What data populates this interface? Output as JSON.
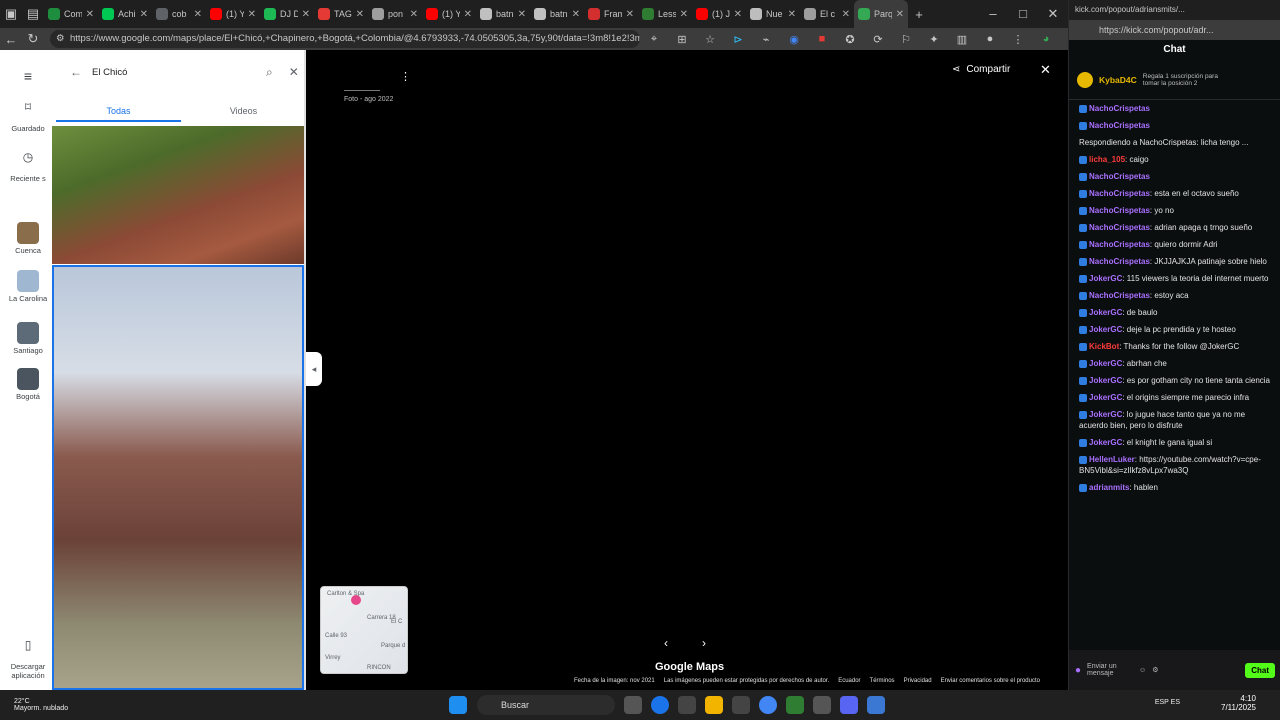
{
  "browser": {
    "tabs": [
      {
        "label": "Com",
        "color": "#1e8e3e"
      },
      {
        "label": "Achi",
        "color": "#00c853"
      },
      {
        "label": "cob",
        "color": "#5f6368"
      },
      {
        "label": "(1) Y",
        "color": "#ff0000"
      },
      {
        "label": "DJ D",
        "color": "#1db954"
      },
      {
        "label": "TAG",
        "color": "#e53935"
      },
      {
        "label": "pon",
        "color": "#9e9e9e"
      },
      {
        "label": "(1) Y",
        "color": "#ff0000"
      },
      {
        "label": "batn",
        "color": "#c0c0c0"
      },
      {
        "label": "batn",
        "color": "#c0c0c0"
      },
      {
        "label": "Fram",
        "color": "#d32f2f"
      },
      {
        "label": "Less",
        "color": "#2e7d32"
      },
      {
        "label": "(1) Ju",
        "color": "#ff0000"
      },
      {
        "label": "Nue",
        "color": "#bdbdbd"
      },
      {
        "label": "El c",
        "color": "#9e9e9e"
      },
      {
        "label": "Parq",
        "color": "#34a853",
        "active": true
      }
    ],
    "url": "https://www.google.com/maps/place/El+Chicó,+Chapinero,+Bogotá,+Colombia/@4.6793933,-74.0505305,3a,75y,90t/data=!3m8!1e2!3m6!1sCIHM..."
  },
  "maps": {
    "rail": [
      {
        "label": "Guardado",
        "icon": "bookmark-icon"
      },
      {
        "label": "Reciente s",
        "icon": "history-icon"
      },
      {
        "label": "Cuenca",
        "icon": "place-thumb"
      },
      {
        "label": "La Carolina",
        "icon": "place-thumb"
      },
      {
        "label": "Santiago",
        "icon": "place-thumb"
      },
      {
        "label": "Bogotá",
        "icon": "place-thumb"
      },
      {
        "label": "Descargar aplicación",
        "icon": "phone-icon"
      }
    ],
    "search_value": "El Chicó",
    "tabs": [
      "Todas",
      "Videos"
    ],
    "photo_date": "Foto - ago 2022",
    "share_label": "Compartir",
    "minimap_labels": [
      "Carlton & Spa",
      "Carrera 18",
      "Calle 93",
      "Virrey",
      "Parque d",
      "RINCON",
      "El C"
    ],
    "brand": "Google Maps",
    "footer": [
      "Fecha de la imagen: nov 2021",
      "Las imágenes pueden estar protegidas por derechos de autor.",
      "Ecuador",
      "Términos",
      "Privacidad",
      "Enviar comentarios sobre el producto"
    ]
  },
  "chat": {
    "window_title": "kick.com/popout/adriansmits/...",
    "url": "https://kick.com/popout/adr...",
    "title": "Chat",
    "pinned_user": "KybaD4C",
    "pinned_text": "Regala 1 suscripción para tomar la posición 2",
    "messages": [
      {
        "user": "NachoCrispetas",
        "text": ""
      },
      {
        "user": "NachoCrispetas",
        "text": ""
      },
      {
        "user": "",
        "text": "Respondiendo a NachoCrispetas: licha tengo ..."
      },
      {
        "user": "licha_105",
        "text": ": caigo",
        "red": true
      },
      {
        "user": "NachoCrispetas",
        "text": ""
      },
      {
        "user": "NachoCrispetas",
        "text": ": esta en el octavo sueño"
      },
      {
        "user": "NachoCrispetas",
        "text": ": yo no"
      },
      {
        "user": "NachoCrispetas",
        "text": ": adrian apaga q trngo sueño"
      },
      {
        "user": "NachoCrispetas",
        "text": ": quiero dormir Adri"
      },
      {
        "user": "NachoCrispetas",
        "text": ": JKJJAJKJA patinaje sobre hielo"
      },
      {
        "user": "JokerGC",
        "text": ": 115 viewers la teoria del internet muerto"
      },
      {
        "user": "NachoCrispetas",
        "text": ": estoy aca"
      },
      {
        "user": "JokerGC",
        "text": ": de baulo"
      },
      {
        "user": "JokerGC",
        "text": ": deje la pc prendida y te hosteo"
      },
      {
        "user": "KickBot",
        "text": ": Thanks for the follow @JokerGC",
        "red": true
      },
      {
        "user": "JokerGC",
        "text": ": abrhan che"
      },
      {
        "user": "JokerGC",
        "text": ": es por gotham city no tiene tanta ciencia"
      },
      {
        "user": "JokerGC",
        "text": ": el origins siempre me parecio infra"
      },
      {
        "user": "JokerGC",
        "text": ": lo jugue hace tanto que ya no me acuerdo bien, pero lo disfrute"
      },
      {
        "user": "JokerGC",
        "text": ": el knight le gana igual si"
      },
      {
        "user": "HellenLuker",
        "text": ": https://youtube.com/watch?v=cpe-BN5Vibl&si=zIlkfz8vLpx7wa3Q"
      },
      {
        "user": "adrianmits",
        "text": ": hablen"
      }
    ],
    "send_placeholder": "Enviar un mensaje",
    "chat_button": "Chat"
  },
  "taskbar": {
    "search": "Buscar",
    "weather_temp": "22°C",
    "weather_desc": "Mayorm. nublado",
    "lang": "ESP ES",
    "time": "4:10",
    "date": "7/11/2025"
  }
}
